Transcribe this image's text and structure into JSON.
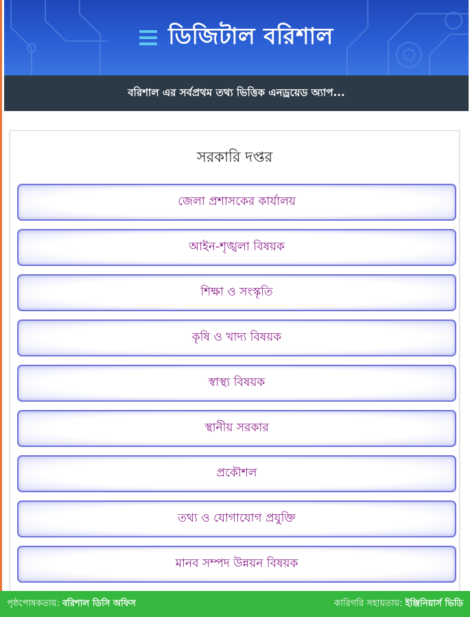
{
  "header": {
    "title": "ডিজিটাল বরিশাল",
    "tagline": "বরিশাল এর সর্বপ্রথম তথ্য ভিত্তিক এনড্রয়েড অ্যাপ...",
    "accent_color": "#2b5fd6",
    "menu_icon": "hamburger-menu-icon"
  },
  "panel": {
    "title": "সরকারি দপ্তর",
    "items": [
      {
        "label": "জেলা প্রশাসকের কার্যালয়"
      },
      {
        "label": "আইন-শৃঙ্খলা বিষয়ক"
      },
      {
        "label": "শিক্ষা ও সংস্কৃতি"
      },
      {
        "label": "কৃষি ও খাদ্য বিষয়ক"
      },
      {
        "label": "স্বাস্থ্য বিষয়ক"
      },
      {
        "label": "স্থানীয় সরকার"
      },
      {
        "label": "প্রকৌশল"
      },
      {
        "label": "তথ্য ও যোগাযোগ প্রযুক্তি"
      },
      {
        "label": "মানব সম্পদ উন্নয়ন বিষয়ক"
      }
    ]
  },
  "footer": {
    "sponsor_label": "পৃষ্ঠপোষকতায়:",
    "sponsor_value": "বরিশাল ডিসি অফিস",
    "tech_label": "কারিগরি সহায়তায়:",
    "tech_value": "ইঞ্জিনিয়ার্স ভিডি",
    "color": "#35b83e"
  }
}
